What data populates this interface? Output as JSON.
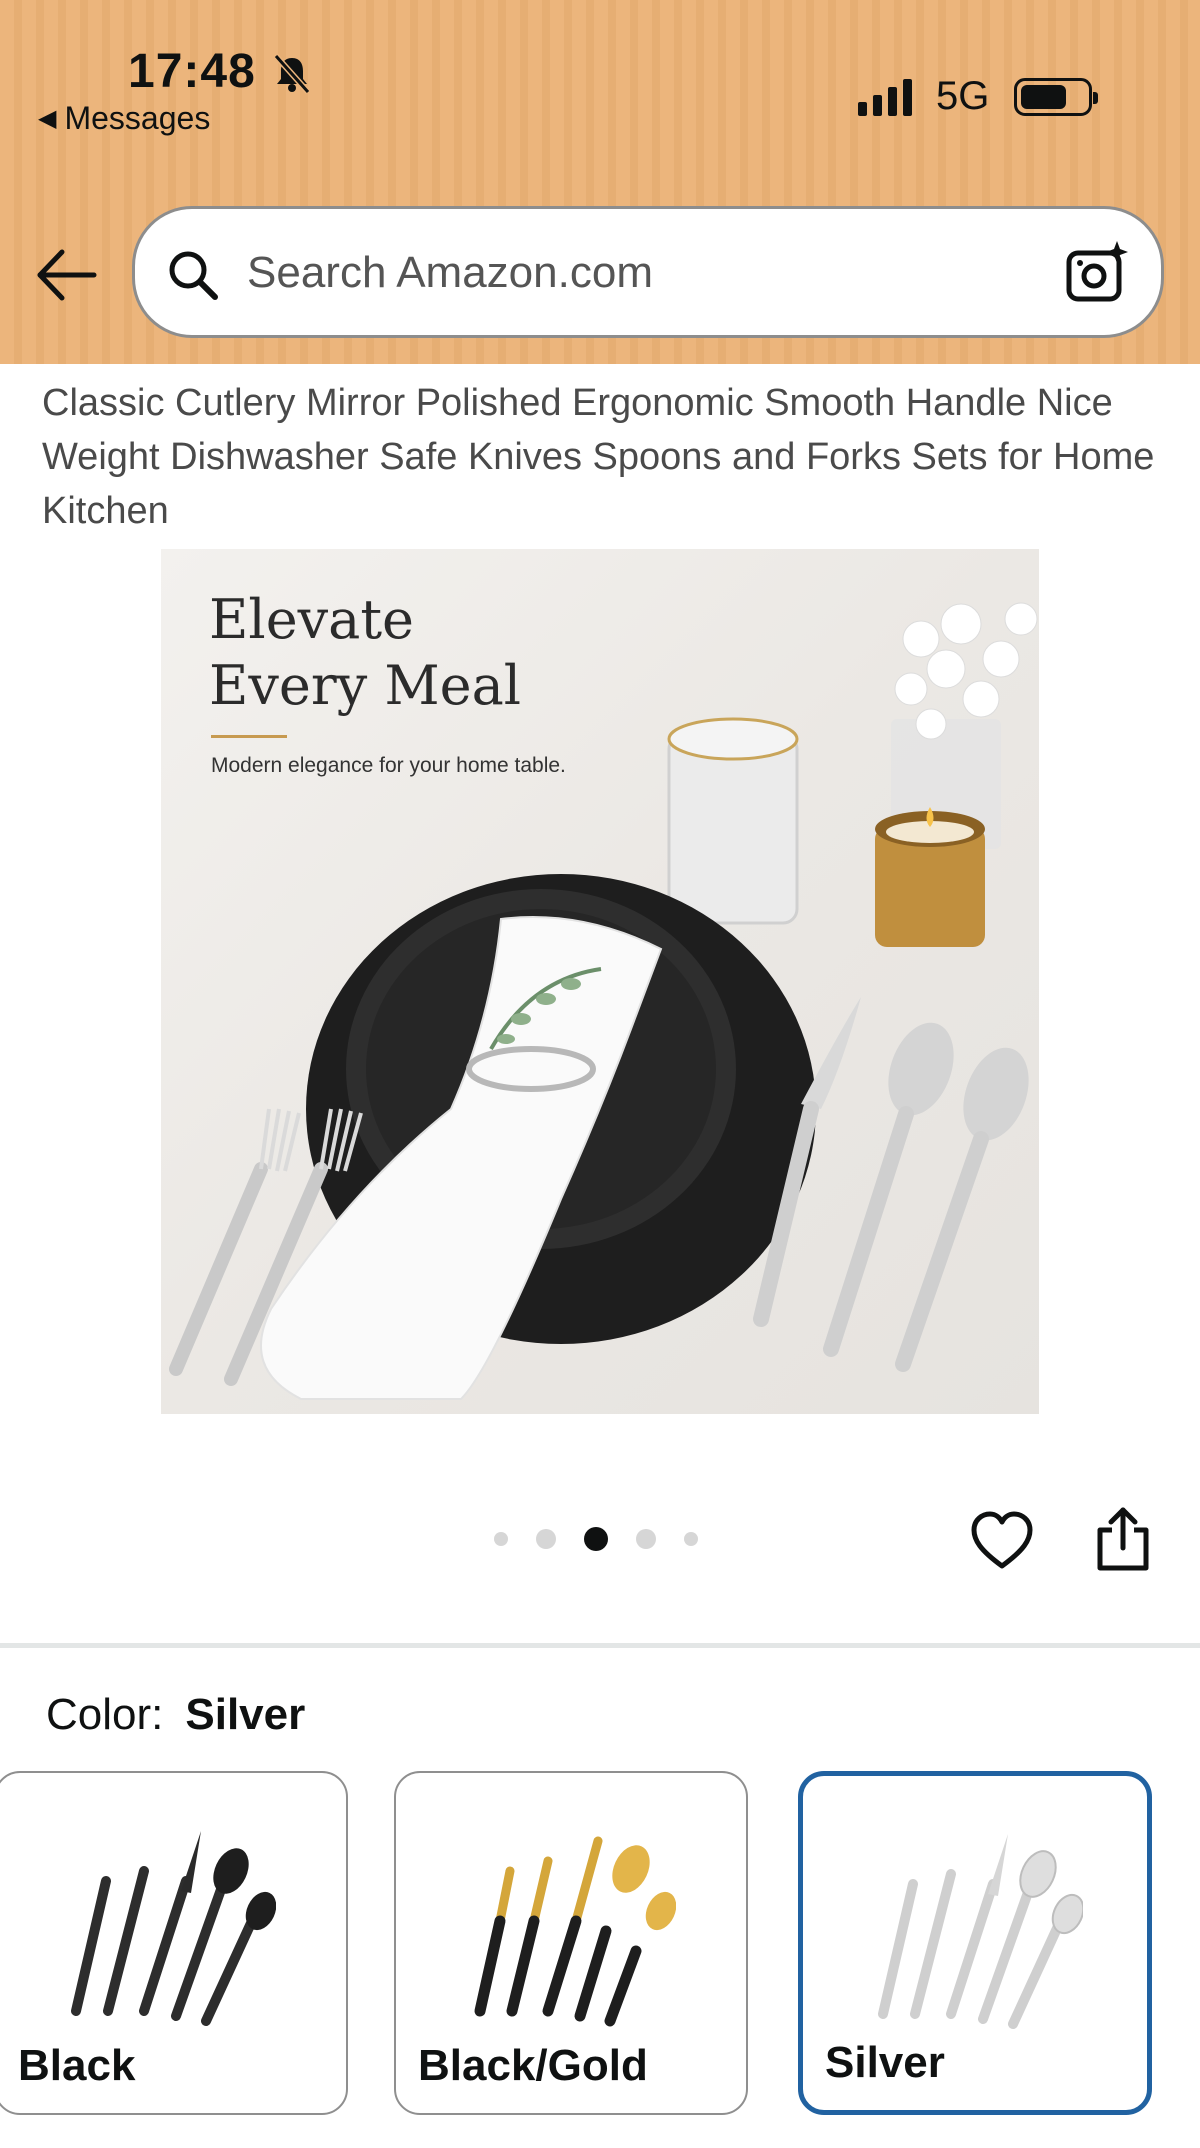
{
  "status_bar": {
    "time": "17:48",
    "back_app": "Messages",
    "network": "5G"
  },
  "search": {
    "placeholder": "Search Amazon.com"
  },
  "product": {
    "title": "Classic Cutlery Mirror Polished Ergonomic Smooth Handle Nice Weight Dishwasher Safe Knives Spoons and Forks Sets for Home Kitchen"
  },
  "hero_image": {
    "headline_line1": "Elevate",
    "headline_line2": "Every Meal",
    "tagline": "Modern elegance for your home table."
  },
  "carousel": {
    "total": 5,
    "active_index": 2
  },
  "color": {
    "label": "Color:",
    "selected": "Silver",
    "options": [
      {
        "label": "Black",
        "selected": false
      },
      {
        "label": "Black/Gold",
        "selected": false
      },
      {
        "label": "Silver",
        "selected": true
      }
    ]
  },
  "colors": {
    "header_bg": "#ecb57c",
    "selected_border": "#2162a1"
  }
}
